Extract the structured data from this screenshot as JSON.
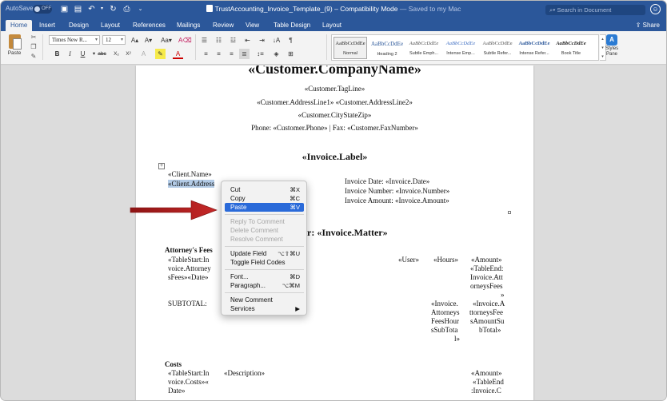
{
  "window": {
    "autosave_label": "AutoSave",
    "autosave_state": "OFF",
    "title": "TrustAccounting_Invoice_Template_(9)",
    "mode": "Compatibility Mode",
    "saved_status": "— Saved to my Mac",
    "title_separator": "–",
    "search_placeholder": "Search in Document"
  },
  "tabs": [
    {
      "label": "Home",
      "active": true
    },
    {
      "label": "Insert"
    },
    {
      "label": "Design"
    },
    {
      "label": "Layout"
    },
    {
      "label": "References"
    },
    {
      "label": "Mailings"
    },
    {
      "label": "Review"
    },
    {
      "label": "View"
    },
    {
      "label": "Table Design"
    },
    {
      "label": "Layout"
    }
  ],
  "share_label": "Share",
  "ribbon": {
    "paste_label": "Paste",
    "font_name": "Times New R...",
    "font_size": "12",
    "styles": [
      {
        "sample": "AaBbCcDdEe",
        "name": "Normal",
        "selected": true
      },
      {
        "sample": "AaBbCcDdEe",
        "name": "Heading 2"
      },
      {
        "sample": "AaBbCcDdEe",
        "name": "Subtle Emph..."
      },
      {
        "sample": "AaBbCcDdEe",
        "name": "Intense Emp..."
      },
      {
        "sample": "AaBbCcDdEe",
        "name": "Subtle Refer..."
      },
      {
        "sample": "AaBbCcDdEe",
        "name": "Intense Refer..."
      },
      {
        "sample": "AaBbCcDdEe",
        "name": "Book Title"
      }
    ],
    "styles_pane_label": "Styles Pane",
    "accent": "#2b579a"
  },
  "document": {
    "company_name": "«Customer.CompanyName»",
    "tagline": "«Customer.TagLine»",
    "address": "«Customer.AddressLine1» «Customer.AddressLine2»",
    "city_state_zip": "«Customer.CityStateZip»",
    "phone_fax": "Phone: «Customer.Phone»   |   Fax: «Customer.FaxNumber»",
    "invoice_label": "«Invoice.Label»",
    "client_name": "«Client.Name»",
    "client_address": "«Client.Address",
    "invoice_date": "Invoice Date: «Invoice.Date»",
    "invoice_number": "Invoice Number: «Invoice.Number»",
    "invoice_amount": "Invoice Amount: «Invoice.Amount»",
    "matter_heading": "r: «Invoice.Matter»",
    "attorney_fees_heading": "Attorney's Fees",
    "attorney_fees_lines": [
      "«TableStart:In",
      "voice.Attorney",
      "sFees»«Date»"
    ],
    "col_user": "«User»",
    "col_hours": "«Hours»",
    "col_amount_lines": [
      "«Amount»",
      "«TableEnd:",
      "Invoice.Att",
      "orneysFees",
      "»"
    ],
    "subtotal_label": "SUBTOTAL:",
    "subtotal_hours_lines": [
      "«Invoice.",
      "Attorneys",
      "FeesHour",
      "sSubTota",
      "l»"
    ],
    "subtotal_amount_lines": [
      "«Invoice.A",
      "ttorneysFee",
      "sAmountSu",
      "bTotal»"
    ],
    "costs_heading": "Costs",
    "costs_lines": [
      "«TableStart:In",
      "voice.Costs»«",
      "Date»"
    ],
    "costs_description": "«Description»",
    "costs_amount_lines": [
      "«Amount»",
      "«TableEnd",
      ":Invoice.C"
    ]
  },
  "context_menu": {
    "items": [
      {
        "label": "Cut",
        "shortcut": "⌘X"
      },
      {
        "label": "Copy",
        "shortcut": "⌘C"
      },
      {
        "label": "Paste",
        "shortcut": "⌘V",
        "highlighted": true
      },
      {
        "label": "Reply To Comment",
        "disabled": true
      },
      {
        "label": "Delete Comment",
        "disabled": true
      },
      {
        "label": "Resolve Comment",
        "disabled": true
      },
      {
        "label": "Update Field",
        "shortcut": "⌥⇧⌘U"
      },
      {
        "label": "Toggle Field Codes"
      },
      {
        "label": "Font...",
        "shortcut": "⌘D"
      },
      {
        "label": "Paragraph...",
        "shortcut": "⌥⌘M"
      },
      {
        "label": "New Comment"
      },
      {
        "label": "Services",
        "shortcut": "▶"
      }
    ]
  },
  "annotation_arrow_color": "#b22222"
}
